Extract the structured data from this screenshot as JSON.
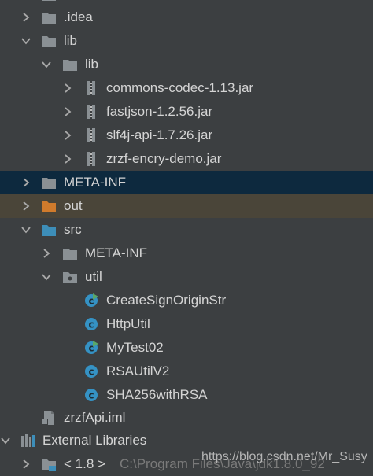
{
  "tree": {
    "idea": "idea",
    "idea_dot": ".idea",
    "lib": "lib",
    "lib_inner": "lib",
    "jar1": "commons-codec-1.13.jar",
    "jar2": "fastjson-1.2.56.jar",
    "jar3": "slf4j-api-1.7.26.jar",
    "jar4": "zrzf-encry-demo.jar",
    "meta_inf": "META-INF",
    "out": "out",
    "src": "src",
    "src_meta_inf": "META-INF",
    "util": "util",
    "class1": "CreateSignOriginStr",
    "class2": "HttpUtil",
    "class3": "MyTest02",
    "class4": "RSAUtilV2",
    "class5": "SHA256withRSA",
    "iml": "zrzfApi.iml",
    "external_libraries": "External Libraries",
    "jdk_label": "< 1.8 >",
    "jdk_path": "C:\\Program Files\\Java\\jdk1.8.0_92"
  },
  "watermark": "https://blog.csdn.net/Mr_Susy",
  "colors": {
    "background": "#3c3f41",
    "selected_row": "#0d293e",
    "out_row": "#4a4539",
    "folder": "#8a9094",
    "folder_blue": "#3d8eb9",
    "folder_orange": "#d07b2c",
    "class_icon": "#3592c4"
  }
}
